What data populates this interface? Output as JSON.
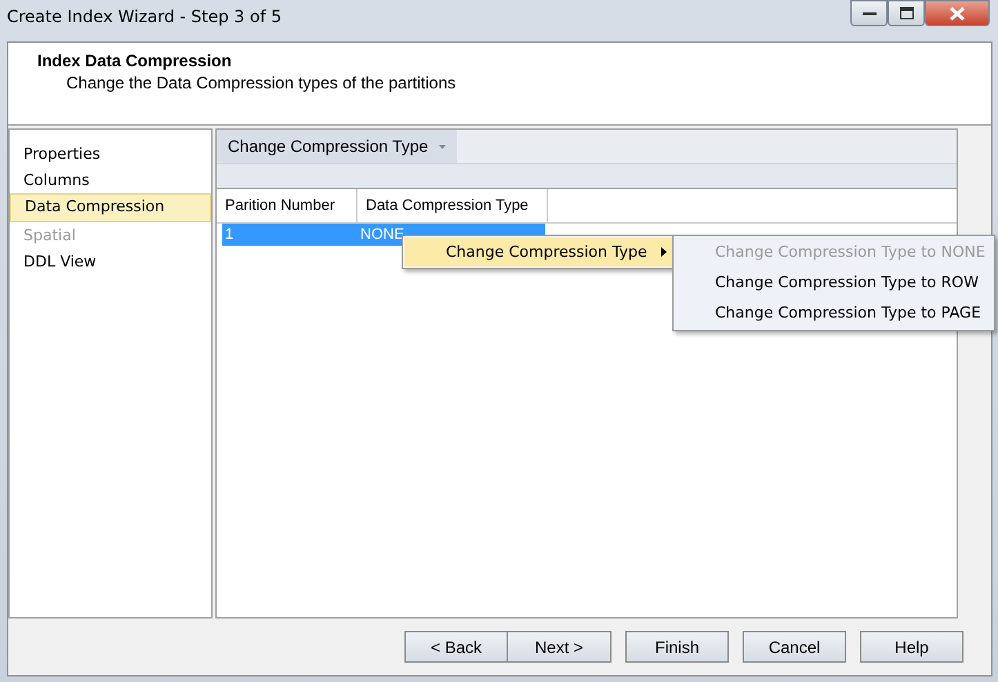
{
  "window": {
    "title": "Create Index Wizard - Step 3 of 5"
  },
  "header": {
    "title": "Index Data Compression",
    "subtitle": "Change the Data Compression types of the partitions"
  },
  "sidebar": {
    "items": [
      {
        "label": "Properties",
        "selected": false,
        "disabled": false
      },
      {
        "label": "Columns",
        "selected": false,
        "disabled": false
      },
      {
        "label": "Data Compression",
        "selected": true,
        "disabled": false
      },
      {
        "label": "Spatial",
        "selected": false,
        "disabled": true
      },
      {
        "label": "DDL View",
        "selected": false,
        "disabled": false
      }
    ]
  },
  "toolbar": {
    "dropdown": "Change Compression Type"
  },
  "table": {
    "columns": [
      "Parition Number",
      "Data Compression Type"
    ],
    "rows": [
      {
        "cells": [
          "1",
          "NONE"
        ],
        "selected": true
      }
    ]
  },
  "context_menu": {
    "items": [
      {
        "label": "Change Compression Type",
        "expanded": true
      }
    ]
  },
  "submenu": {
    "items": [
      {
        "label": "Change Compression Type to NONE",
        "disabled": true
      },
      {
        "label": "Change Compression Type to ROW",
        "disabled": false
      },
      {
        "label": "Change Compression Type to PAGE",
        "disabled": false
      }
    ]
  },
  "buttons": [
    "< Back",
    "Next >",
    "Finish",
    "Cancel",
    "Help"
  ]
}
